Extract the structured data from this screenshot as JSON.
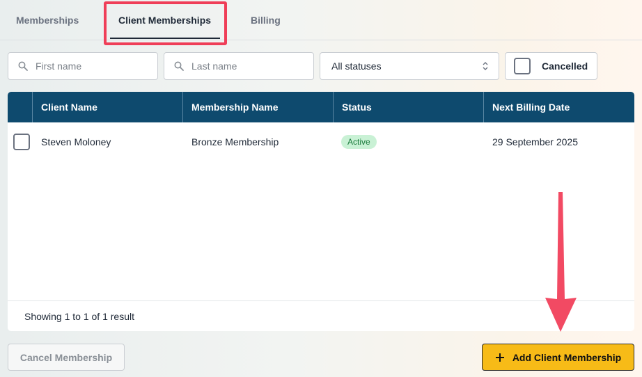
{
  "tabs": [
    {
      "label": "Memberships"
    },
    {
      "label": "Client Memberships"
    },
    {
      "label": "Billing"
    }
  ],
  "filters": {
    "first_name_placeholder": "First name",
    "last_name_placeholder": "Last name",
    "status_select": "All statuses",
    "cancelled_label": "Cancelled"
  },
  "table": {
    "columns": [
      "Client Name",
      "Membership Name",
      "Status",
      "Next Billing Date"
    ],
    "rows": [
      {
        "client": "Steven Moloney",
        "membership": "Bronze Membership",
        "status": "Active",
        "next_billing": "29 September 2025"
      }
    ],
    "footer": "Showing 1 to 1 of 1 result"
  },
  "actions": {
    "cancel_label": "Cancel Membership",
    "add_label": "Add Client Membership"
  },
  "colors": {
    "header_bg": "#0e4a6e",
    "highlight": "#ef3e58",
    "primary_button": "#f7bb17",
    "active_badge": "#c9f1d5"
  },
  "icons": [
    "search-icon",
    "chevron-updown-icon",
    "plus-icon",
    "annotation-arrow"
  ]
}
